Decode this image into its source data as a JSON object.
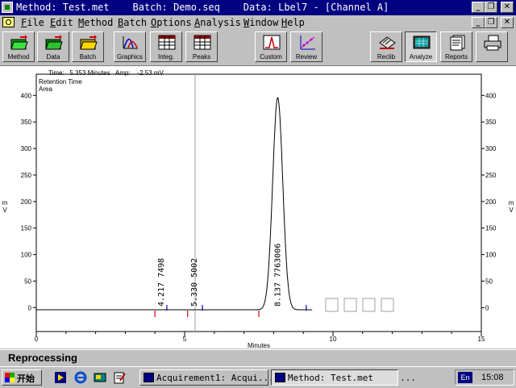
{
  "window": {
    "title": "Method: Test.met    Batch: Demo.seq    Data: Lbel7 - [Channel A]",
    "controls": [
      "_",
      "❐",
      "✕"
    ],
    "doc_controls": [
      "_",
      "❐",
      "✕"
    ]
  },
  "menu": [
    "File",
    "Edit",
    "Method",
    "Batch",
    "Options",
    "Analysis",
    "Window",
    "Help"
  ],
  "toolbar": {
    "left": [
      {
        "label": "Method",
        "icon": "folder-open-icon"
      },
      {
        "label": "Data",
        "icon": "folder-green-icon"
      },
      {
        "label": "Batch",
        "icon": "folder-yellow-icon"
      },
      {
        "label": "Graphics",
        "icon": "graphics-icon"
      },
      {
        "label": "Integ.",
        "icon": "integration-table-icon"
      },
      {
        "label": "Peaks",
        "icon": "peaks-table-icon"
      },
      {
        "label": "Custom",
        "icon": "custom-chart-icon"
      },
      {
        "label": "Review",
        "icon": "review-scatter-icon"
      }
    ],
    "right": [
      {
        "label": "Reclib",
        "icon": "reclib-icon"
      },
      {
        "label": "Analyze",
        "icon": "analyze-icon"
      },
      {
        "label": "Reports",
        "icon": "reports-icon"
      },
      {
        "label": "",
        "icon": "printer-icon"
      }
    ]
  },
  "readout": "Time:   5.353 Minutes   Amp:    -2.53 mV",
  "chart_data": {
    "type": "line",
    "legend_lines": [
      "Retention Time",
      "Area"
    ],
    "xlabel": "Minutes",
    "ylabel": "mV",
    "xlim": [
      0,
      15
    ],
    "ylim": [
      -45,
      440
    ],
    "x_ticks": [
      0,
      5,
      10,
      15
    ],
    "y_ticks": [
      0,
      50,
      100,
      150,
      200,
      250,
      300,
      350,
      400
    ],
    "grid": false,
    "cursor_x": 5.353,
    "peak_labels": [
      "4.217  7498",
      "5.330  5002",
      "8.137  7763006"
    ],
    "peaks": [
      {
        "rt": 4.217,
        "area": 7498,
        "height": 0,
        "start": 4.0,
        "end": 4.4
      },
      {
        "rt": 5.33,
        "area": 5002,
        "height": 0,
        "start": 5.1,
        "end": 5.6
      },
      {
        "rt": 8.137,
        "area": 7763006,
        "height": 400,
        "start": 7.5,
        "end": 9.1
      }
    ],
    "baseline": -4
  },
  "status": "Reprocessing",
  "taskbar": {
    "start_label": "开始",
    "tasks": [
      "Acquirement1: Acqui...",
      "Method: Test.met     ..."
    ],
    "lang": "En",
    "clock": "15:08"
  }
}
